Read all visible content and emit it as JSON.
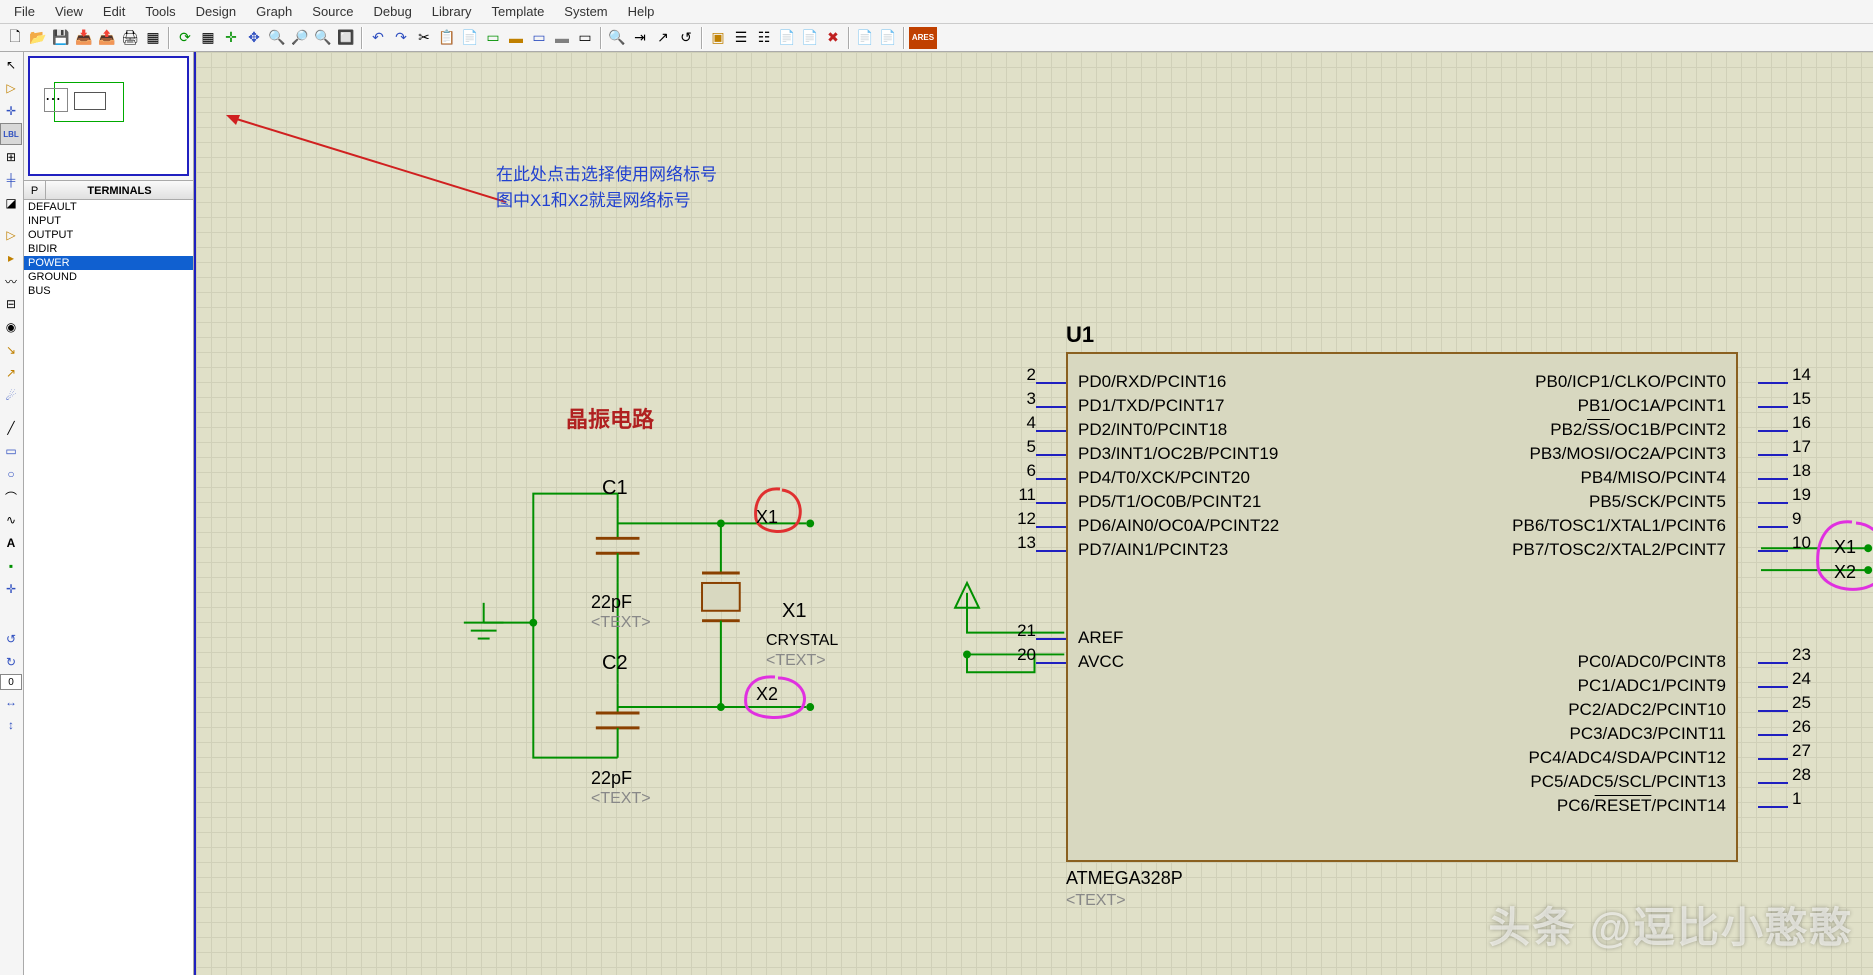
{
  "menu": [
    "File",
    "View",
    "Edit",
    "Tools",
    "Design",
    "Graph",
    "Source",
    "Debug",
    "Library",
    "Template",
    "System",
    "Help"
  ],
  "toolbar_icons": {
    "new": "🗋",
    "open": "📂",
    "save": "💾",
    "import": "📥",
    "export": "📤",
    "print": "🖨",
    "area": "▦",
    "refresh": "⟳",
    "grid": "▦",
    "origin": "✛",
    "pan": "✥",
    "zoomin": "🔍",
    "zoomout": "🔎",
    "zoomall": "🔍",
    "zoomarea": "🔲",
    "undo": "↶",
    "redo": "↷",
    "cut": "✂",
    "copy": "📋",
    "paste": "📄",
    "block1": "▭",
    "block2": "▬",
    "block3": "▭",
    "block4": "▬",
    "block5": "▭",
    "find": "🔍",
    "goto": "⇥",
    "point": "↗",
    "arc": "↺",
    "tool1": "▣",
    "tool2": "☰",
    "tool3": "☷",
    "doc1": "📄",
    "doc2": "📄",
    "bad": "✖",
    "doc3": "📄",
    "doc4": "📄",
    "ares": "ARES"
  },
  "left_tools": {
    "select": "↖",
    "component": "▷",
    "junction": "✛",
    "label": "LBL",
    "text": "⊞",
    "bus": "╪",
    "subckt": "◪",
    "terminal": "▷",
    "pin": "▸",
    "graph": "〰",
    "tape": "⊟",
    "gen": "◉",
    "probe": "↘",
    "vprobe": "↗",
    "line": "╱",
    "box": "▭",
    "circle": "○",
    "arc": "⌒",
    "path": "∿",
    "chars": "A",
    "sym": "▪",
    "rot_ccw": "↺",
    "rot_cw": "↻",
    "angle": "0",
    "mirror_h": "↔",
    "mirror_v": "↕"
  },
  "terminals_header": {
    "p": "P",
    "title": "TERMINALS"
  },
  "terminals": [
    "DEFAULT",
    "INPUT",
    "OUTPUT",
    "BIDIR",
    "POWER",
    "GROUND",
    "BUS"
  ],
  "terminals_selected": "POWER",
  "annotation": {
    "line1": "在此处点击选择使用网络标号",
    "line2": "图中X1和X2就是网络标号"
  },
  "crystal_title": "晶振电路",
  "c1": {
    "ref": "C1",
    "val": "22pF",
    "txt": "<TEXT>"
  },
  "c2": {
    "ref": "C2",
    "val": "22pF",
    "txt": "<TEXT>"
  },
  "x1": {
    "ref": "X1",
    "type": "CRYSTAL",
    "txt": "<TEXT>"
  },
  "netlabels": {
    "x1": "X1",
    "x2": "X2"
  },
  "u1": {
    "ref": "U1",
    "part": "ATMEGA328P",
    "txt": "<TEXT>"
  },
  "pins_left": [
    {
      "num": "2",
      "lbl": "PD0/RXD/PCINT16"
    },
    {
      "num": "3",
      "lbl": "PD1/TXD/PCINT17"
    },
    {
      "num": "4",
      "lbl": "PD2/INT0/PCINT18"
    },
    {
      "num": "5",
      "lbl": "PD3/INT1/OC2B/PCINT19"
    },
    {
      "num": "6",
      "lbl": "PD4/T0/XCK/PCINT20"
    },
    {
      "num": "11",
      "lbl": "PD5/T1/OC0B/PCINT21"
    },
    {
      "num": "12",
      "lbl": "PD6/AIN0/OC0A/PCINT22"
    },
    {
      "num": "13",
      "lbl": "PD7/AIN1/PCINT23"
    }
  ],
  "pins_left2": [
    {
      "num": "21",
      "lbl": "AREF"
    },
    {
      "num": "20",
      "lbl": "AVCC"
    }
  ],
  "pins_right": [
    {
      "num": "14",
      "lbl": "PB0/ICP1/CLKO/PCINT0"
    },
    {
      "num": "15",
      "lbl": "PB1/OC1A/PCINT1"
    },
    {
      "num": "16",
      "lbl": "PB2/<bar>SS</bar>/OC1B/PCINT2"
    },
    {
      "num": "17",
      "lbl": "PB3/MOSI/OC2A/PCINT3"
    },
    {
      "num": "18",
      "lbl": "PB4/MISO/PCINT4"
    },
    {
      "num": "19",
      "lbl": "PB5/SCK/PCINT5"
    },
    {
      "num": "9",
      "lbl": "PB6/TOSC1/XTAL1/PCINT6"
    },
    {
      "num": "10",
      "lbl": "PB7/TOSC2/XTAL2/PCINT7"
    }
  ],
  "pins_right2": [
    {
      "num": "23",
      "lbl": "PC0/ADC0/PCINT8"
    },
    {
      "num": "24",
      "lbl": "PC1/ADC1/PCINT9"
    },
    {
      "num": "25",
      "lbl": "PC2/ADC2/PCINT10"
    },
    {
      "num": "26",
      "lbl": "PC3/ADC3/PCINT11"
    },
    {
      "num": "27",
      "lbl": "PC4/ADC4/SDA/PCINT12"
    },
    {
      "num": "28",
      "lbl": "PC5/ADC5/SCL/PCINT13"
    },
    {
      "num": "1",
      "lbl": "PC6/<bar>RESET</bar>/PCINT14"
    }
  ],
  "watermark": "头条 @逗比小憨憨"
}
